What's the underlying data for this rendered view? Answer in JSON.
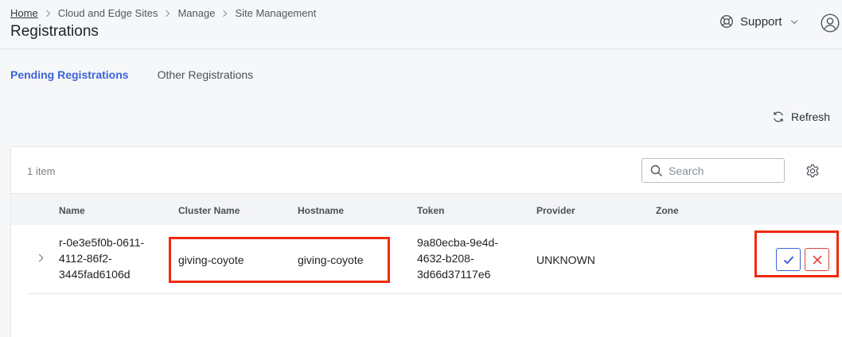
{
  "breadcrumb": {
    "items": [
      "Home",
      "Cloud and Edge Sites",
      "Manage",
      "Site Management"
    ]
  },
  "page": {
    "title": "Registrations"
  },
  "header": {
    "support_label": "Support"
  },
  "tabs": [
    {
      "label": "Pending Registrations",
      "active": true
    },
    {
      "label": "Other Registrations",
      "active": false
    }
  ],
  "toolbar": {
    "refresh_label": "Refresh"
  },
  "table": {
    "item_count": "1 item",
    "search_placeholder": "Search",
    "columns": [
      "Name",
      "Cluster Name",
      "Hostname",
      "Token",
      "Provider",
      "Zone"
    ],
    "rows": [
      {
        "name_lines": [
          "r-0e3e5f0b-0611-",
          "4112-86f2-",
          "3445fad6106d"
        ],
        "cluster_name": "giving-coyote",
        "hostname": "giving-coyote",
        "token_lines": [
          "9a80ecba-9e4d-",
          "4632-b208-",
          "3d66d37117e6"
        ],
        "provider": "UNKNOWN",
        "zone": ""
      }
    ]
  },
  "colors": {
    "accent": "#3b63d8",
    "danger": "#e0443a",
    "highlight": "#f02a10"
  },
  "icons": {
    "support": "lifebuoy-icon",
    "user": "user-icon",
    "refresh": "refresh-icon",
    "search": "search-icon",
    "settings": "gear-icon",
    "approve": "check-icon",
    "reject": "close-icon"
  }
}
